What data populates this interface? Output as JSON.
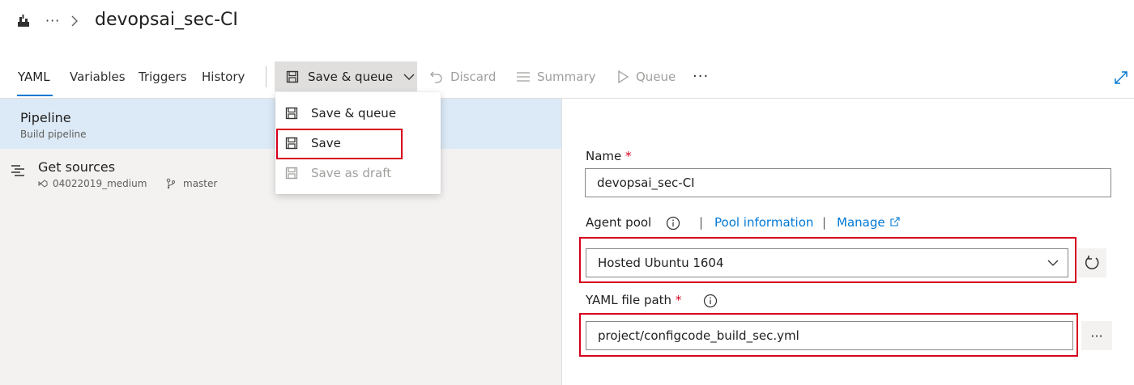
{
  "header": {
    "logo_icon": "build-pipeline-icon",
    "breadcrumb_more": "···",
    "title": "devopsai_sec-CI"
  },
  "toolbar": {
    "tabs": [
      {
        "label": "YAML",
        "active": true
      },
      {
        "label": "Variables",
        "active": false
      },
      {
        "label": "Triggers",
        "active": false
      },
      {
        "label": "History",
        "active": false
      }
    ],
    "save_queue_label": "Save & queue",
    "discard_label": "Discard",
    "summary_label": "Summary",
    "queue_label": "Queue",
    "more_label": "···"
  },
  "menu": {
    "items": [
      {
        "label": "Save & queue",
        "enabled": true
      },
      {
        "label": "Save",
        "enabled": true,
        "highlighted": true
      },
      {
        "label": "Save as draft",
        "enabled": false
      }
    ]
  },
  "left_pane": {
    "pipeline_title": "Pipeline",
    "pipeline_subtitle": "Build pipeline",
    "sources_title": "Get sources",
    "repo": "04022019_medium",
    "branch": "master"
  },
  "form": {
    "name_label": "Name",
    "required_mark": "*",
    "name_value": "devopsai_sec-CI",
    "agent_pool_label": "Agent pool",
    "pipe": "|",
    "pool_info_link": "Pool information",
    "manage_link": "Manage",
    "agent_pool_value": "Hosted Ubuntu 1604",
    "yaml_path_label": "YAML file path",
    "yaml_path_value": "project/configcode_build_sec.yml",
    "browse_label": "···"
  },
  "colors": {
    "accent": "#0078d4",
    "highlight_box": "#d6001c",
    "selected_row": "#dce9f6"
  }
}
